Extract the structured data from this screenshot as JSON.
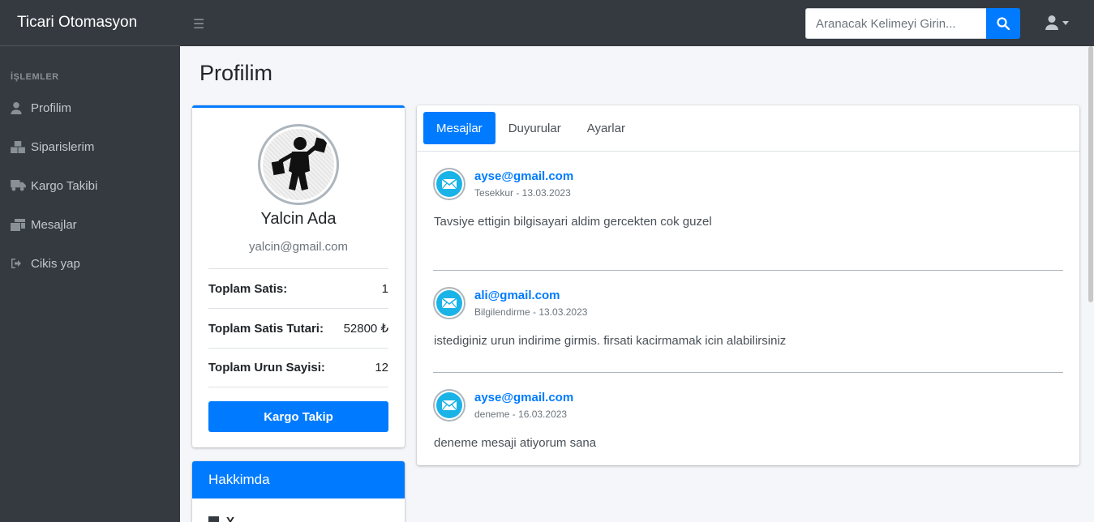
{
  "app": {
    "brand": "Ticari Otomasyon"
  },
  "sidebar": {
    "header": "İŞLEMLER",
    "items": [
      {
        "label": "Profilim",
        "icon": "user-icon"
      },
      {
        "label": "Siparislerim",
        "icon": "boxes-icon"
      },
      {
        "label": "Kargo Takibi",
        "icon": "truck-icon"
      },
      {
        "label": "Mesajlar",
        "icon": "mail-bulk-icon"
      },
      {
        "label": "Cikis yap",
        "icon": "sign-out-icon"
      }
    ]
  },
  "topbar": {
    "search_placeholder": "Aranacak Kelimeyi Girin...",
    "menu_icon": "hamburger-icon",
    "search_icon": "search-icon",
    "user_icon": "user-icon"
  },
  "page": {
    "title": "Profilim"
  },
  "profile": {
    "name": "Yalcin Ada",
    "email": "yalcin@gmail.com",
    "stats": [
      {
        "label": "Toplam Satis:",
        "value": "1"
      },
      {
        "label": "Toplam Satis Tutari:",
        "value": "52800 ₺"
      },
      {
        "label": "Toplam Urun Sayisi:",
        "value": "12"
      }
    ],
    "button": "Kargo Takip"
  },
  "about": {
    "title": "Hakkimda",
    "first_item": "Y..."
  },
  "tabs": [
    {
      "label": "Mesajlar",
      "active": true
    },
    {
      "label": "Duyurular",
      "active": false
    },
    {
      "label": "Ayarlar",
      "active": false
    }
  ],
  "messages": [
    {
      "from": "ayse@gmail.com",
      "meta": "Tesekkur - 13.03.2023",
      "text": "Tavsiye ettigin bilgisayari aldim gercekten cok guzel"
    },
    {
      "from": "ali@gmail.com",
      "meta": "Bilgilendirme - 13.03.2023",
      "text": "istediginiz urun indirime girmis. firsati kacirmamak icin alabilirsiniz"
    },
    {
      "from": "ayse@gmail.com",
      "meta": "deneme - 16.03.2023",
      "text": "deneme mesaji atiyorum sana"
    }
  ],
  "colors": {
    "primary": "#007bff",
    "sidebar": "#343a40",
    "background": "#f4f6f9"
  }
}
